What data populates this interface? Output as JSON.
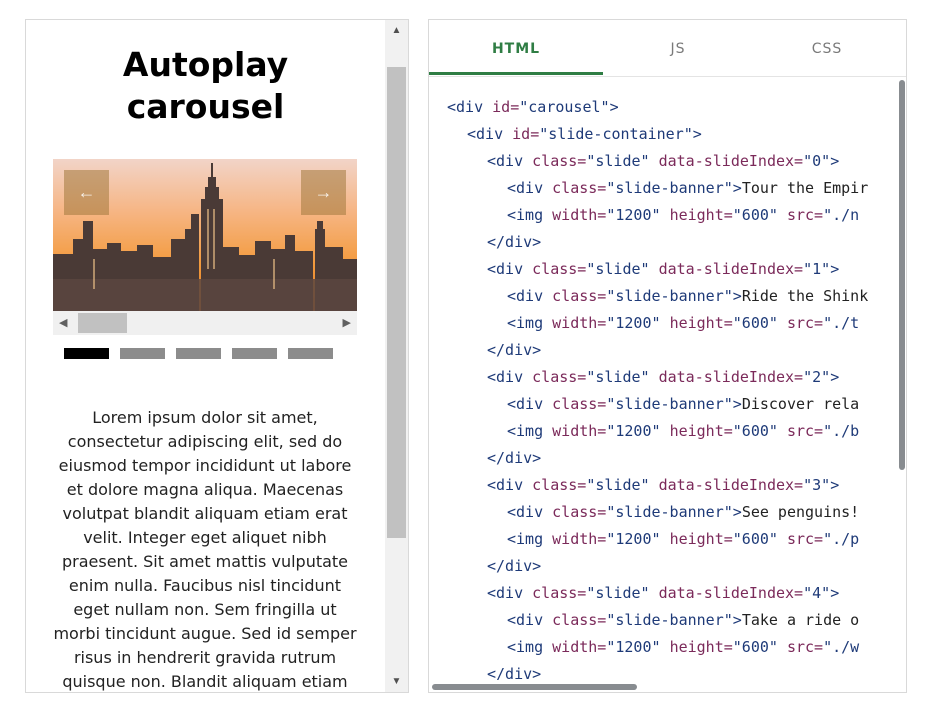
{
  "preview": {
    "title_line1": "Autoplay",
    "title_line2": "carousel",
    "carousel": {
      "prev_glyph": "←",
      "next_glyph": "→",
      "slide_count": 5,
      "active_slide": 0
    },
    "lorem": "Lorem ipsum dolor sit amet, consectetur adipiscing elit, sed do eiusmod tempor incididunt ut labore et dolore magna aliqua. Maecenas volutpat blandit aliquam etiam erat velit. Integer eget aliquet nibh praesent. Sit amet mattis vulputate enim nulla. Faucibus nisl tincidunt eget nullam non. Sem fringilla ut morbi tincidunt augue. Sed id semper risus in hendrerit gravida rutrum quisque non. Blandit aliquam etiam"
  },
  "editor": {
    "tabs": [
      "HTML",
      "JS",
      "CSS"
    ],
    "active_tab": "HTML",
    "lines": [
      {
        "indent": 0,
        "tokens": [
          [
            "tag",
            "<div "
          ],
          [
            "attr",
            "id="
          ],
          [
            "str",
            "\"carousel\""
          ],
          [
            "tag",
            ">"
          ]
        ]
      },
      {
        "indent": 1,
        "tokens": [
          [
            "tag",
            "<div "
          ],
          [
            "attr",
            "id="
          ],
          [
            "str",
            "\"slide-container\""
          ],
          [
            "tag",
            ">"
          ]
        ]
      },
      {
        "indent": 2,
        "tokens": [
          [
            "tag",
            "<div "
          ],
          [
            "attr",
            "class="
          ],
          [
            "str",
            "\"slide\" "
          ],
          [
            "attr",
            "data-slideIndex="
          ],
          [
            "str",
            "\"0\""
          ],
          [
            "tag",
            ">"
          ]
        ]
      },
      {
        "indent": 3,
        "tokens": [
          [
            "tag",
            "<div "
          ],
          [
            "attr",
            "class="
          ],
          [
            "str",
            "\"slide-banner\""
          ],
          [
            "tag",
            ">"
          ],
          [
            "txt",
            "Tour the Empir"
          ]
        ]
      },
      {
        "indent": 3,
        "tokens": [
          [
            "tag",
            "<img "
          ],
          [
            "attr",
            "width="
          ],
          [
            "str",
            "\"1200\" "
          ],
          [
            "attr",
            "height="
          ],
          [
            "str",
            "\"600\" "
          ],
          [
            "attr",
            "src="
          ],
          [
            "str",
            "\"./n"
          ]
        ]
      },
      {
        "indent": 2,
        "tokens": [
          [
            "tag",
            "</div>"
          ]
        ]
      },
      {
        "indent": 2,
        "tokens": [
          [
            "tag",
            "<div "
          ],
          [
            "attr",
            "class="
          ],
          [
            "str",
            "\"slide\" "
          ],
          [
            "attr",
            "data-slideIndex="
          ],
          [
            "str",
            "\"1\""
          ],
          [
            "tag",
            ">"
          ]
        ]
      },
      {
        "indent": 3,
        "tokens": [
          [
            "tag",
            "<div "
          ],
          [
            "attr",
            "class="
          ],
          [
            "str",
            "\"slide-banner\""
          ],
          [
            "tag",
            ">"
          ],
          [
            "txt",
            "Ride the Shink"
          ]
        ]
      },
      {
        "indent": 3,
        "tokens": [
          [
            "tag",
            "<img "
          ],
          [
            "attr",
            "width="
          ],
          [
            "str",
            "\"1200\" "
          ],
          [
            "attr",
            "height="
          ],
          [
            "str",
            "\"600\" "
          ],
          [
            "attr",
            "src="
          ],
          [
            "str",
            "\"./t"
          ]
        ]
      },
      {
        "indent": 2,
        "tokens": [
          [
            "tag",
            "</div>"
          ]
        ]
      },
      {
        "indent": 2,
        "tokens": [
          [
            "tag",
            "<div "
          ],
          [
            "attr",
            "class="
          ],
          [
            "str",
            "\"slide\" "
          ],
          [
            "attr",
            "data-slideIndex="
          ],
          [
            "str",
            "\"2\""
          ],
          [
            "tag",
            ">"
          ]
        ]
      },
      {
        "indent": 3,
        "tokens": [
          [
            "tag",
            "<div "
          ],
          [
            "attr",
            "class="
          ],
          [
            "str",
            "\"slide-banner\""
          ],
          [
            "tag",
            ">"
          ],
          [
            "txt",
            "Discover rela"
          ]
        ]
      },
      {
        "indent": 3,
        "tokens": [
          [
            "tag",
            "<img "
          ],
          [
            "attr",
            "width="
          ],
          [
            "str",
            "\"1200\" "
          ],
          [
            "attr",
            "height="
          ],
          [
            "str",
            "\"600\" "
          ],
          [
            "attr",
            "src="
          ],
          [
            "str",
            "\"./b"
          ]
        ]
      },
      {
        "indent": 2,
        "tokens": [
          [
            "tag",
            "</div>"
          ]
        ]
      },
      {
        "indent": 2,
        "tokens": [
          [
            "tag",
            "<div "
          ],
          [
            "attr",
            "class="
          ],
          [
            "str",
            "\"slide\" "
          ],
          [
            "attr",
            "data-slideIndex="
          ],
          [
            "str",
            "\"3\""
          ],
          [
            "tag",
            ">"
          ]
        ]
      },
      {
        "indent": 3,
        "tokens": [
          [
            "tag",
            "<div "
          ],
          [
            "attr",
            "class="
          ],
          [
            "str",
            "\"slide-banner\""
          ],
          [
            "tag",
            ">"
          ],
          [
            "txt",
            "See penguins!"
          ]
        ]
      },
      {
        "indent": 3,
        "tokens": [
          [
            "tag",
            "<img "
          ],
          [
            "attr",
            "width="
          ],
          [
            "str",
            "\"1200\" "
          ],
          [
            "attr",
            "height="
          ],
          [
            "str",
            "\"600\" "
          ],
          [
            "attr",
            "src="
          ],
          [
            "str",
            "\"./p"
          ]
        ]
      },
      {
        "indent": 2,
        "tokens": [
          [
            "tag",
            "</div>"
          ]
        ]
      },
      {
        "indent": 2,
        "tokens": [
          [
            "tag",
            "<div "
          ],
          [
            "attr",
            "class="
          ],
          [
            "str",
            "\"slide\" "
          ],
          [
            "attr",
            "data-slideIndex="
          ],
          [
            "str",
            "\"4\""
          ],
          [
            "tag",
            ">"
          ]
        ]
      },
      {
        "indent": 3,
        "tokens": [
          [
            "tag",
            "<div "
          ],
          [
            "attr",
            "class="
          ],
          [
            "str",
            "\"slide-banner\""
          ],
          [
            "tag",
            ">"
          ],
          [
            "txt",
            "Take a ride o"
          ]
        ]
      },
      {
        "indent": 3,
        "tokens": [
          [
            "tag",
            "<img "
          ],
          [
            "attr",
            "width="
          ],
          [
            "str",
            "\"1200\" "
          ],
          [
            "attr",
            "height="
          ],
          [
            "str",
            "\"600\" "
          ],
          [
            "attr",
            "src="
          ],
          [
            "str",
            "\"./w"
          ]
        ]
      },
      {
        "indent": 2,
        "tokens": [
          [
            "tag",
            "</div>"
          ]
        ]
      }
    ]
  },
  "colors": {
    "active_tab": "#2f7d44",
    "tag": "#1e3a78",
    "attr": "#7b2a5a",
    "indicator_active": "#000000",
    "indicator_inactive": "#8c8c8c"
  },
  "icons": {
    "scroll_up": "▲",
    "scroll_down": "▼",
    "scroll_left": "◀",
    "scroll_right": "▶"
  }
}
